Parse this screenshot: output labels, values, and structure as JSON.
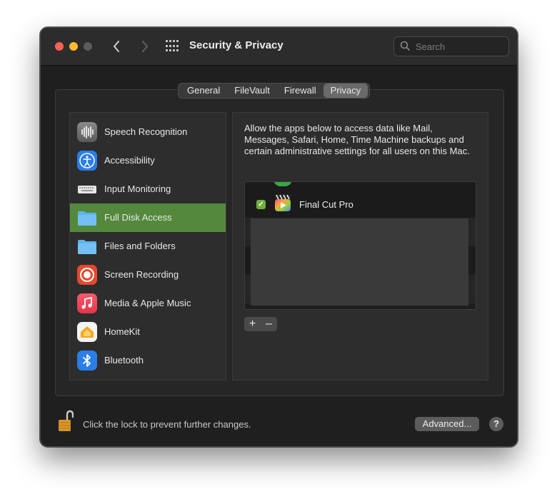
{
  "window": {
    "title": "Security & Privacy",
    "search_placeholder": "Search"
  },
  "tabs": [
    {
      "label": "General",
      "selected": false
    },
    {
      "label": "FileVault",
      "selected": false
    },
    {
      "label": "Firewall",
      "selected": false
    },
    {
      "label": "Privacy",
      "selected": true
    }
  ],
  "sidebar": {
    "items": [
      {
        "label": "Speech Recognition",
        "icon": "waveform-icon"
      },
      {
        "label": "Accessibility",
        "icon": "accessibility-icon"
      },
      {
        "label": "Input Monitoring",
        "icon": "keyboard-icon"
      },
      {
        "label": "Full Disk Access",
        "icon": "folder-icon",
        "selected": true
      },
      {
        "label": "Files and Folders",
        "icon": "folder-icon"
      },
      {
        "label": "Screen Recording",
        "icon": "screen-recording-icon"
      },
      {
        "label": "Media & Apple Music",
        "icon": "music-icon"
      },
      {
        "label": "HomeKit",
        "icon": "home-icon"
      },
      {
        "label": "Bluetooth",
        "icon": "bluetooth-icon"
      }
    ]
  },
  "detail": {
    "description": "Allow the apps below to access data like Mail, Messages, Safari, Home, Time Machine backups and certain administrative settings for all users on this Mac.",
    "apps": [
      {
        "name": "Final Cut Pro",
        "checked": true,
        "icon": "final-cut-pro-icon"
      }
    ],
    "add_label": "+",
    "remove_label": "–"
  },
  "footer": {
    "lock_text": "Click the lock to prevent further changes.",
    "advanced_label": "Advanced...",
    "help_label": "?"
  },
  "colors": {
    "selection": "#54893d",
    "checkbox": "#6fb23b",
    "close": "#ff5f57",
    "minimize": "#febc2e"
  }
}
